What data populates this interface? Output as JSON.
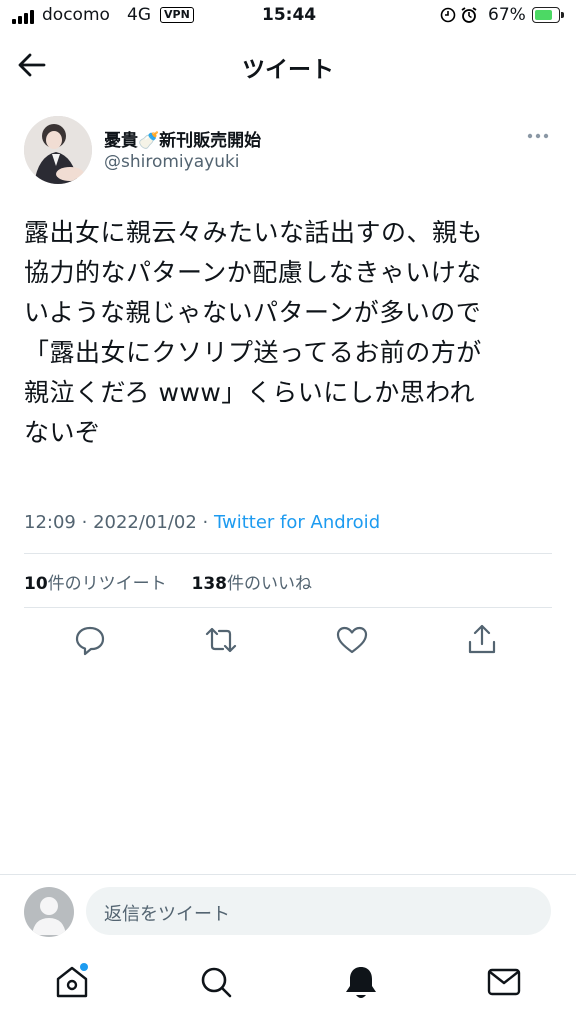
{
  "status_bar": {
    "carrier": "docomo",
    "network": "4G",
    "vpn": "VPN",
    "time": "15:44",
    "battery": "67%",
    "battery_level": 0.67
  },
  "header": {
    "title": "ツイート"
  },
  "tweet": {
    "author_name": "憂貴🍼新刊販売開始",
    "author_handle": "@shiromiyayuki",
    "lines": [
      "露出女に親云々みたいな話出すの、親も",
      "協力的なパターンか配慮しなきゃいけな",
      "いような親じゃないパターンが多いので",
      "「露出女にクソリプ送ってるお前の方が",
      "親泣くだろ www」くらいにしか思われ",
      "ないぞ"
    ],
    "time": "12:09",
    "date": "2022/01/02",
    "source": "Twitter for Android",
    "retweet_count": "10",
    "retweet_label": "件のリツイート",
    "like_count": "138",
    "like_label": "件のいいね"
  },
  "reply": {
    "placeholder": "返信をツイート"
  },
  "colors": {
    "accent": "#1d9bf0",
    "text": "#0f1419",
    "muted": "#536471"
  },
  "icons": [
    "back-arrow-icon",
    "more-icon",
    "reply-icon",
    "retweet-icon",
    "like-icon",
    "share-icon",
    "home-icon",
    "search-icon",
    "notifications-icon",
    "messages-icon"
  ]
}
